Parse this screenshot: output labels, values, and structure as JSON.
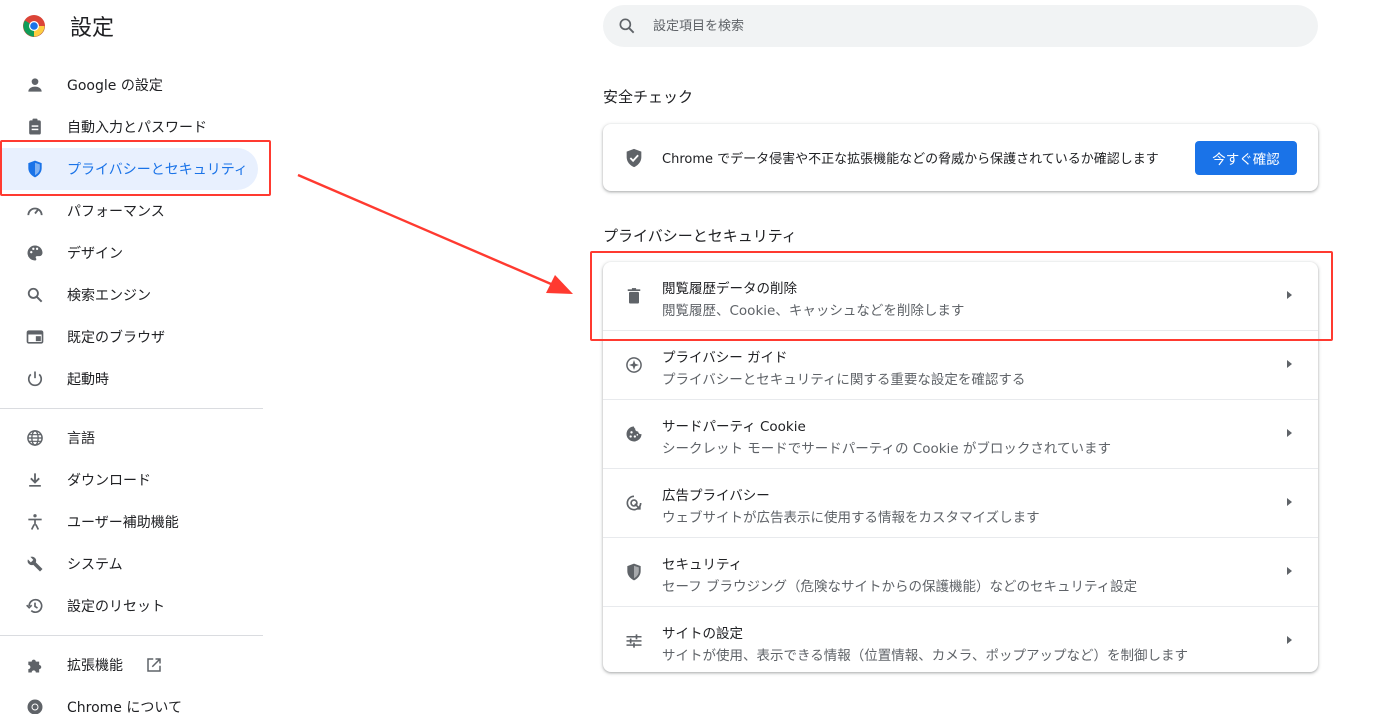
{
  "app": {
    "title": "設定"
  },
  "search": {
    "placeholder": "設定項目を検索"
  },
  "sidebar": {
    "items": [
      {
        "label": "Google の設定",
        "icon": "person-icon"
      },
      {
        "label": "自動入力とパスワード",
        "icon": "clipboard-icon"
      },
      {
        "label": "プライバシーとセキュリティ",
        "icon": "shield-icon",
        "active": true
      },
      {
        "label": "パフォーマンス",
        "icon": "speedometer-icon"
      },
      {
        "label": "デザイン",
        "icon": "palette-icon"
      },
      {
        "label": "検索エンジン",
        "icon": "search-icon"
      },
      {
        "label": "既定のブラウザ",
        "icon": "browser-window-icon"
      },
      {
        "label": "起動時",
        "icon": "power-icon"
      },
      {
        "label": "言語",
        "icon": "globe-icon"
      },
      {
        "label": "ダウンロード",
        "icon": "download-icon"
      },
      {
        "label": "ユーザー補助機能",
        "icon": "accessibility-icon"
      },
      {
        "label": "システム",
        "icon": "wrench-icon"
      },
      {
        "label": "設定のリセット",
        "icon": "history-icon"
      },
      {
        "label": "拡張機能",
        "icon": "puzzle-icon"
      },
      {
        "label": "Chrome について",
        "icon": "chrome-icon"
      }
    ]
  },
  "safety_check": {
    "section_title": "安全チェック",
    "description": "Chrome でデータ侵害や不正な拡張機能などの脅威から保護されているか確認します",
    "button_label": "今すぐ確認"
  },
  "privacy": {
    "section_title": "プライバシーとセキュリティ",
    "rows": [
      {
        "title": "閲覧履歴データの削除",
        "subtitle": "閲覧履歴、Cookie、キャッシュなどを削除します",
        "icon": "trash-icon"
      },
      {
        "title": "プライバシー ガイド",
        "subtitle": "プライバシーとセキュリティに関する重要な設定を確認する",
        "icon": "compass-icon"
      },
      {
        "title": "サードパーティ Cookie",
        "subtitle": "シークレット モードでサードパーティの Cookie がブロックされています",
        "icon": "cookie-icon"
      },
      {
        "title": "広告プライバシー",
        "subtitle": "ウェブサイトが広告表示に使用する情報をカスタマイズします",
        "icon": "ad-privacy-icon"
      },
      {
        "title": "セキュリティ",
        "subtitle": "セーフ ブラウジング（危険なサイトからの保護機能）などのセキュリティ設定",
        "icon": "security-shield-icon"
      },
      {
        "title": "サイトの設定",
        "subtitle": "サイトが使用、表示できる情報（位置情報、カメラ、ポップアップなど）を制御します",
        "icon": "tune-icon"
      }
    ]
  },
  "colors": {
    "accent": "#1a73e8",
    "annotation": "#ff3a30",
    "active_bg": "#e8f0fe"
  }
}
